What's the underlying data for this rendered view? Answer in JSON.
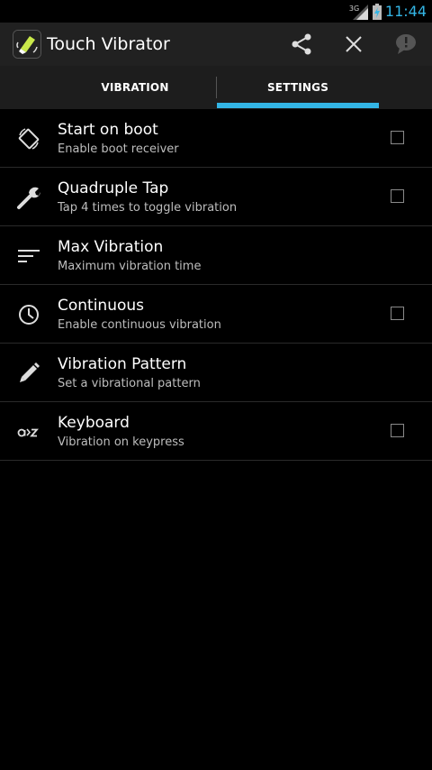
{
  "status_bar": {
    "network": "3G",
    "time": "11:44"
  },
  "action_bar": {
    "title": "Touch Vibrator"
  },
  "tabs": [
    {
      "label": "VIBRATION",
      "selected": false
    },
    {
      "label": "SETTINGS",
      "selected": true
    }
  ],
  "settings": [
    {
      "title": "Start on boot",
      "subtitle": "Enable boot receiver",
      "icon": "screen-rotation-icon",
      "checkbox": true,
      "checked": false
    },
    {
      "title": "Quadruple Tap",
      "subtitle": "Tap 4 times to toggle vibration",
      "icon": "wrench-icon",
      "checkbox": true,
      "checked": false
    },
    {
      "title": "Max Vibration",
      "subtitle": "Maximum vibration time",
      "icon": "sort-lines-icon",
      "checkbox": false
    },
    {
      "title": "Continuous",
      "subtitle": "Enable continuous vibration",
      "icon": "clock-icon",
      "checkbox": true,
      "checked": false
    },
    {
      "title": "Vibration Pattern",
      "subtitle": "Set a vibrational pattern",
      "icon": "pencil-icon",
      "checkbox": false
    },
    {
      "title": "Keyboard",
      "subtitle": "Vibration on keypress",
      "icon": "keyboard-az-icon",
      "checkbox": true,
      "checked": false
    }
  ],
  "colors": {
    "accent": "#33b5e5",
    "background": "#000000",
    "action_bar": "#212121"
  }
}
